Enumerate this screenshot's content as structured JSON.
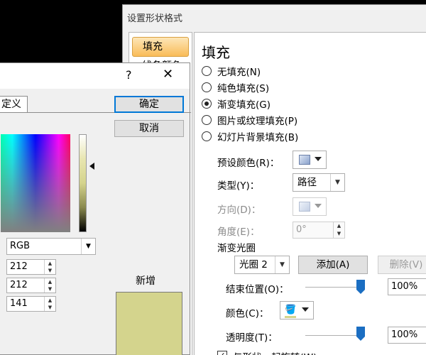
{
  "shape_dialog": {
    "title": "设置形状格式",
    "nav": [
      {
        "label": "填充",
        "active": true
      },
      {
        "label": "线条颜色",
        "active": false
      }
    ],
    "heading": "填充",
    "fill_options": [
      {
        "label": "无填充(N)",
        "checked": false
      },
      {
        "label": "纯色填充(S)",
        "checked": false
      },
      {
        "label": "渐变填充(G)",
        "checked": true
      },
      {
        "label": "图片或纹理填充(P)",
        "checked": false
      },
      {
        "label": "幻灯片背景填充(B)",
        "checked": false
      }
    ],
    "preset_label": "预设颜色(R)：",
    "type_label": "类型(Y)：",
    "type_value": "路径",
    "direction_label": "方向(D)：",
    "angle_label": "角度(E)：",
    "angle_value": "0°",
    "stops_label": "渐变光圈",
    "stop_value": "光圈 2",
    "add_label": "添加(A)",
    "delete_label": "删除(V)",
    "end_pos_label": "结束位置(O)：",
    "end_pos_value": "100%",
    "color_label": "颜色(C)：",
    "transparency_label": "透明度(T)：",
    "transparency_value": "100%",
    "rotate_label": "与形状一起旋转(W)",
    "rotate_checked": true
  },
  "color_dialog": {
    "help_glyph": "?",
    "close_glyph": "✕",
    "tab_label": "定义",
    "ok_label": "确定",
    "cancel_label": "取消",
    "color_mode": "RGB",
    "red": "212",
    "green": "212",
    "blue": "141",
    "new_label": "新增",
    "new_color": "#d4d48d"
  }
}
